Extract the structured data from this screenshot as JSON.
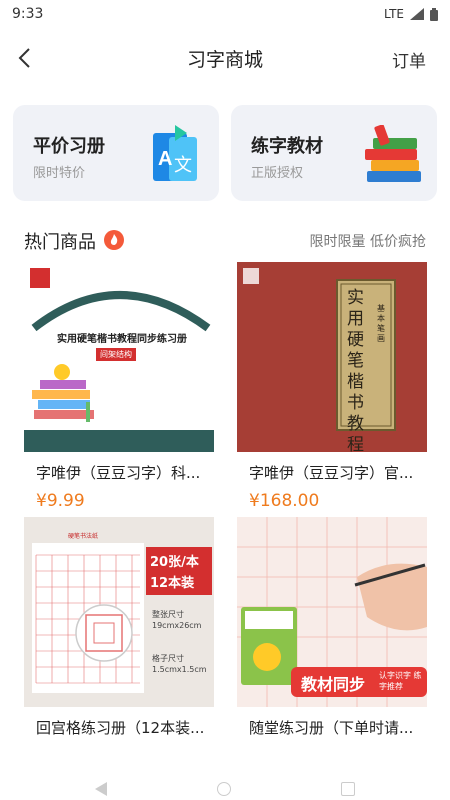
{
  "status": {
    "time": "9:33",
    "network": "LTE"
  },
  "nav": {
    "title": "习字商城",
    "orders_label": "订单"
  },
  "categories": [
    {
      "title": "平价习册",
      "subtitle": "限时特价",
      "icon": "translate-book-icon"
    },
    {
      "title": "练字教材",
      "subtitle": "正版授权",
      "icon": "book-stack-icon"
    }
  ],
  "section": {
    "title": "热门商品",
    "tagline": "限时限量 低价疯抢"
  },
  "products": [
    {
      "name": "字唯伊（豆豆习字）科...",
      "price": "¥9.99",
      "cover_title": "实用硬笔楷书教程同步练习册",
      "cover_tag": "间架结构"
    },
    {
      "name": "字唯伊（豆豆习字）官...",
      "price": "¥168.00",
      "cover_title": "实用硬笔楷书教程",
      "cover_side": "基本笔画"
    },
    {
      "name": "回宫格练习册（12本装...",
      "price": "",
      "cover_badge_1": "20张/本",
      "cover_badge_2": "12本装",
      "cover_size_1": "整张尺寸",
      "cover_size_1v": "19cmx26cm",
      "cover_size_2": "格子尺寸",
      "cover_size_2v": "1.5cmx1.5cm",
      "cover_header": "硬笔书法纸"
    },
    {
      "name": "随堂练习册（下单时请...",
      "price": "",
      "cover_banner": "教材同步",
      "cover_banner_sub": "认字识字 练字推荐"
    }
  ],
  "colors": {
    "accent": "#ef7b1e",
    "hot": "#f45a3a",
    "card_bg": "#f0f2f7"
  }
}
